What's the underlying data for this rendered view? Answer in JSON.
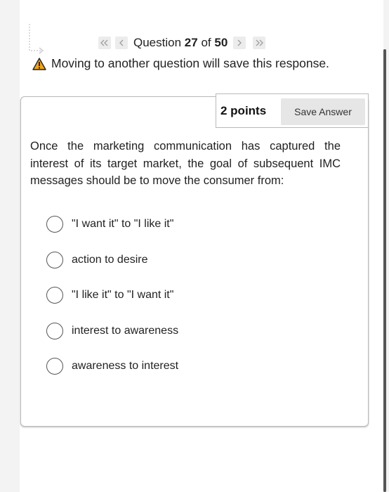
{
  "nav": {
    "first_icon": "double-chevron-left-icon",
    "prev_icon": "chevron-left-icon",
    "question_prefix": "Question",
    "current": "27",
    "of_label": "of",
    "total": "50",
    "next_icon": "chevron-right-icon",
    "last_icon": "double-chevron-right-icon"
  },
  "warning": {
    "icon": "warning-icon",
    "text": "Moving to another question will save this response."
  },
  "points_label": "2 points",
  "save_label": "Save Answer",
  "question_text": "Once the marketing communication has captured the interest of its target market, the goal of subsequent IMC messages should be to move the consumer from:",
  "options": [
    {
      "label": "\"I want it\" to \"I like it\""
    },
    {
      "label": "action to desire"
    },
    {
      "label": "\"I like it\" to \"I want it\""
    },
    {
      "label": "interest to awareness"
    },
    {
      "label": "awareness to interest"
    }
  ],
  "colors": {
    "warning_fill": "#f0a21b",
    "nav_button_bg": "#ececec",
    "save_button_bg": "#e6e6e6"
  }
}
